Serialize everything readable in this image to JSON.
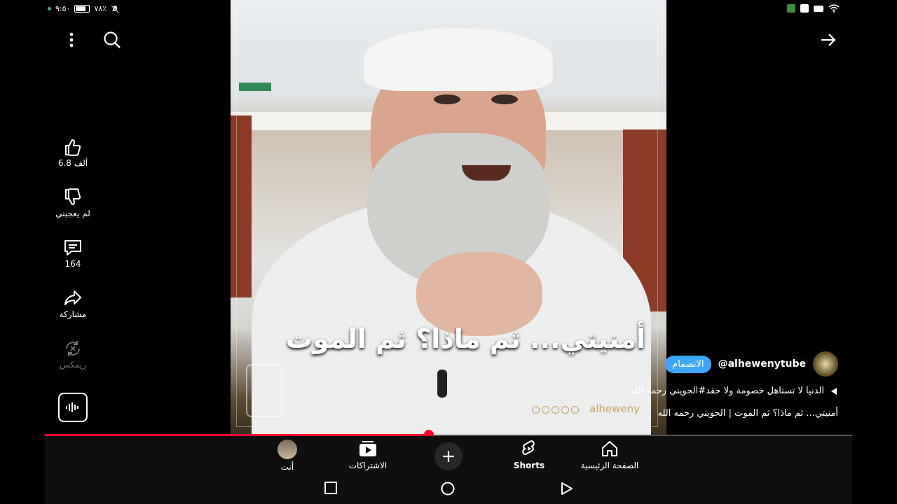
{
  "status_bar": {
    "time": "٩:٥٠",
    "battery": "٧٨٪"
  },
  "video": {
    "overlay_title": "أمنيتي... ثم ماذا؟ ثم الموت",
    "watermark": "alheweny"
  },
  "actions": {
    "like_count": "6.8 ألف",
    "dislike_label": "لم يعجبني",
    "comments_count": "164",
    "share_label": "مشاركة",
    "remix_label": "ريمكس"
  },
  "channel": {
    "handle": "@alhewenytube",
    "join_label": "الانضمام"
  },
  "description": {
    "playlist_line": "الدنيا لا تستاهل خصومة ولا حقد#الحويني رحمه الله",
    "video_title": "أمنيتي... ثم ماذا؟ ثم الموت | الحويني رحمه الله"
  },
  "progress": {
    "fraction": 0.476
  },
  "bottom_nav": {
    "home": "الصفحة الرئيسية",
    "shorts": "Shorts",
    "subscriptions": "الاشتراكات",
    "you": "أنت"
  },
  "colors": {
    "accent_red": "#ff0033",
    "join_blue": "#3ea6ff"
  }
}
